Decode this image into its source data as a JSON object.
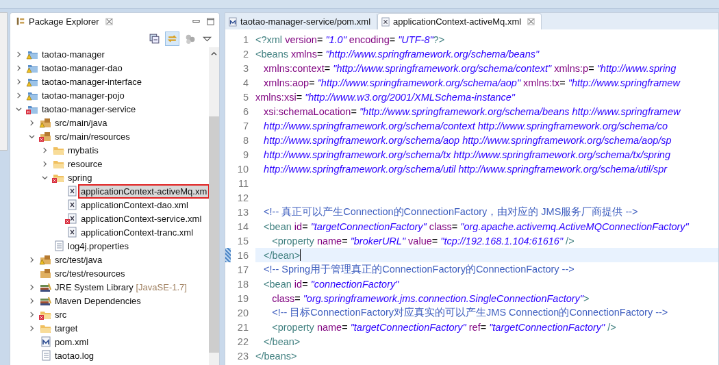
{
  "explorer": {
    "title": "Package Explorer",
    "tree": [
      {
        "label": "taotao-manager",
        "kind": "project",
        "warning": true,
        "error": false,
        "expanded": false,
        "selected": false
      },
      {
        "label": "taotao-manager-dao",
        "kind": "project",
        "warning": true,
        "error": false,
        "expanded": false,
        "selected": false
      },
      {
        "label": "taotao-manager-interface",
        "kind": "project",
        "warning": true,
        "error": false,
        "expanded": false,
        "selected": false
      },
      {
        "label": "taotao-manager-pojo",
        "kind": "project",
        "warning": true,
        "error": false,
        "expanded": false,
        "selected": false
      },
      {
        "label": "taotao-manager-service",
        "kind": "project",
        "warning": false,
        "error": true,
        "expanded": true,
        "selected": false,
        "children": [
          {
            "label": "src/main/java",
            "kind": "package",
            "warning": true,
            "error": false,
            "expanded": false,
            "selected": false
          },
          {
            "label": "src/main/resources",
            "kind": "package",
            "warning": false,
            "error": true,
            "expanded": true,
            "selected": false,
            "children": [
              {
                "label": "mybatis",
                "kind": "folder",
                "warning": false,
                "error": false,
                "expanded": false,
                "selected": false
              },
              {
                "label": "resource",
                "kind": "folder",
                "warning": false,
                "error": false,
                "expanded": false,
                "selected": false
              },
              {
                "label": "spring",
                "kind": "folder",
                "warning": false,
                "error": true,
                "expanded": true,
                "selected": false,
                "children": [
                  {
                    "label": "applicationContext-activeMq.xm",
                    "kind": "xml",
                    "warning": false,
                    "error": false,
                    "selected": true
                  },
                  {
                    "label": "applicationContext-dao.xml",
                    "kind": "xml",
                    "warning": false,
                    "error": false,
                    "selected": false
                  },
                  {
                    "label": "applicationContext-service.xml",
                    "kind": "xml",
                    "warning": false,
                    "error": true,
                    "selected": false
                  },
                  {
                    "label": "applicationContext-tranc.xml",
                    "kind": "xml",
                    "warning": false,
                    "error": false,
                    "selected": false
                  }
                ]
              },
              {
                "label": "log4j.properties",
                "kind": "file",
                "warning": false,
                "error": false,
                "selected": false
              }
            ]
          },
          {
            "label": "src/test/java",
            "kind": "package",
            "warning": true,
            "error": false,
            "expanded": false,
            "selected": false
          },
          {
            "label": "src/test/resources",
            "kind": "package",
            "warning": false,
            "error": false,
            "selected": false
          },
          {
            "label": "JRE System Library",
            "decoration": "[JavaSE-1.7]",
            "kind": "library",
            "warning": false,
            "error": false,
            "expanded": false,
            "selected": false
          },
          {
            "label": "Maven Dependencies",
            "kind": "library",
            "warning": false,
            "error": false,
            "expanded": false,
            "selected": false
          },
          {
            "label": "src",
            "kind": "folder",
            "warning": false,
            "error": true,
            "expanded": false,
            "selected": false
          },
          {
            "label": "target",
            "kind": "folder",
            "warning": false,
            "error": false,
            "expanded": false,
            "selected": false
          },
          {
            "label": "pom.xml",
            "kind": "pom",
            "warning": false,
            "error": false,
            "selected": false
          },
          {
            "label": "taotao.log",
            "kind": "file",
            "warning": false,
            "error": false,
            "selected": false
          }
        ]
      }
    ]
  },
  "editor": {
    "tabs": [
      {
        "label": "taotao-manager-service/pom.xml",
        "kind": "pom",
        "selected": false
      },
      {
        "label": "applicationContext-activeMq.xml",
        "kind": "xml",
        "selected": true
      }
    ],
    "lines": [
      {
        "no": "1",
        "current": false,
        "tokens": [
          {
            "kind": "tag",
            "text": "<?xml "
          },
          {
            "kind": "attr",
            "text": "version"
          },
          {
            "kind": "punct",
            "text": "= "
          },
          {
            "kind": "str",
            "text": "\"1.0\" "
          },
          {
            "kind": "attr",
            "text": "encoding"
          },
          {
            "kind": "punct",
            "text": "= "
          },
          {
            "kind": "str",
            "text": "\"UTF-8\""
          },
          {
            "kind": "tag",
            "text": "?>"
          }
        ]
      },
      {
        "no": "2",
        "current": false,
        "tokens": [
          {
            "kind": "tag",
            "text": "<beans "
          },
          {
            "kind": "attr",
            "text": "xmlns"
          },
          {
            "kind": "punct",
            "text": "= "
          },
          {
            "kind": "str",
            "text": "\"http://www.springframework.org/schema/beans\""
          }
        ]
      },
      {
        "no": "3",
        "current": false,
        "tokens": [
          {
            "kind": "attr",
            "text": "   xmlns:context"
          },
          {
            "kind": "punct",
            "text": "= "
          },
          {
            "kind": "str",
            "text": "\"http://www.springframework.org/schema/context\" "
          },
          {
            "kind": "attr",
            "text": "xmlns:p"
          },
          {
            "kind": "punct",
            "text": "= "
          },
          {
            "kind": "str",
            "text": "\"http://www.spring"
          }
        ]
      },
      {
        "no": "4",
        "current": false,
        "tokens": [
          {
            "kind": "attr",
            "text": "   xmlns:aop"
          },
          {
            "kind": "punct",
            "text": "= "
          },
          {
            "kind": "str",
            "text": "\"http://www.springframework.org/schema/aop\" "
          },
          {
            "kind": "attr",
            "text": "xmlns:tx"
          },
          {
            "kind": "punct",
            "text": "= "
          },
          {
            "kind": "str",
            "text": "\"http://www.springframew"
          }
        ]
      },
      {
        "no": "5",
        "current": false,
        "tokens": [
          {
            "kind": "attr",
            "text": "xmlns:xsi"
          },
          {
            "kind": "punct",
            "text": "= "
          },
          {
            "kind": "str",
            "text": "\"http://www.w3.org/2001/XMLSchema-instance\""
          }
        ]
      },
      {
        "no": "6",
        "current": false,
        "tokens": [
          {
            "kind": "attr",
            "text": "   xsi:schemaLocation"
          },
          {
            "kind": "punct",
            "text": "= "
          },
          {
            "kind": "str",
            "text": "\"http://www.springframework.org/schema/beans http://www.springframew"
          }
        ]
      },
      {
        "no": "7",
        "current": false,
        "tokens": [
          {
            "kind": "str",
            "text": "   http://www.springframework.org/schema/context http://www.springframework.org/schema/co"
          }
        ]
      },
      {
        "no": "8",
        "current": false,
        "tokens": [
          {
            "kind": "str",
            "text": "   http://www.springframework.org/schema/aop http://www.springframework.org/schema/aop/sp"
          }
        ]
      },
      {
        "no": "9",
        "current": false,
        "tokens": [
          {
            "kind": "str",
            "text": "   http://www.springframework.org/schema/tx http://www.springframework.org/schema/tx/spring"
          }
        ]
      },
      {
        "no": "10",
        "current": false,
        "tokens": [
          {
            "kind": "str",
            "text": "   http://www.springframework.org/schema/util http://www.springframework.org/schema/util/spr"
          }
        ]
      },
      {
        "no": "11",
        "current": false
      },
      {
        "no": "12",
        "current": false
      },
      {
        "no": "13",
        "current": false,
        "tokens": [
          {
            "kind": "comment",
            "text": "   <!-- 真正可以产生Connection的ConnectionFactory，由对应的 JMS服务厂商提供 -->"
          }
        ]
      },
      {
        "no": "14",
        "current": false,
        "tokens": [
          {
            "kind": "tag",
            "text": "   <bean "
          },
          {
            "kind": "attr",
            "text": "id"
          },
          {
            "kind": "punct",
            "text": "= "
          },
          {
            "kind": "str",
            "text": "\"targetConnectionFactory\" "
          },
          {
            "kind": "attr",
            "text": "class"
          },
          {
            "kind": "punct",
            "text": "= "
          },
          {
            "kind": "str",
            "text": "\"org.apache.activemq.ActiveMQConnectionFactory\""
          }
        ]
      },
      {
        "no": "15",
        "current": false,
        "tokens": [
          {
            "kind": "tag",
            "text": "      <property "
          },
          {
            "kind": "attr",
            "text": "name"
          },
          {
            "kind": "punct",
            "text": "= "
          },
          {
            "kind": "str",
            "text": "\"brokerURL\" "
          },
          {
            "kind": "attr",
            "text": "value"
          },
          {
            "kind": "punct",
            "text": "= "
          },
          {
            "kind": "str",
            "text": "\"tcp://192.168.1.104:61616\""
          },
          {
            "kind": "tag",
            "text": " />"
          }
        ]
      },
      {
        "no": "16",
        "current": true,
        "tokens": [
          {
            "kind": "tag",
            "text": "   </bean>"
          }
        ]
      },
      {
        "no": "17",
        "current": false,
        "tokens": [
          {
            "kind": "comment",
            "text": "   <!-- Spring用于管理真正的ConnectionFactory的ConnectionFactory -->"
          }
        ]
      },
      {
        "no": "18",
        "current": false,
        "tokens": [
          {
            "kind": "tag",
            "text": "   <bean "
          },
          {
            "kind": "attr",
            "text": "id"
          },
          {
            "kind": "punct",
            "text": "= "
          },
          {
            "kind": "str",
            "text": "\"connectionFactory\""
          }
        ]
      },
      {
        "no": "19",
        "current": false,
        "tokens": [
          {
            "kind": "attr",
            "text": "      class"
          },
          {
            "kind": "punct",
            "text": "= "
          },
          {
            "kind": "str",
            "text": "\"org.springframework.jms.connection.SingleConnectionFactory\""
          },
          {
            "kind": "tag",
            "text": ">"
          }
        ]
      },
      {
        "no": "20",
        "current": false,
        "tokens": [
          {
            "kind": "comment",
            "text": "      <!-- 目标ConnectionFactory对应真实的可以产生JMS Connection的ConnectionFactory -->"
          }
        ]
      },
      {
        "no": "21",
        "current": false,
        "tokens": [
          {
            "kind": "tag",
            "text": "      <property "
          },
          {
            "kind": "attr",
            "text": "name"
          },
          {
            "kind": "punct",
            "text": "= "
          },
          {
            "kind": "str",
            "text": "\"targetConnectionFactory\" "
          },
          {
            "kind": "attr",
            "text": "ref"
          },
          {
            "kind": "punct",
            "text": "= "
          },
          {
            "kind": "str",
            "text": "\"targetConnectionFactory\""
          },
          {
            "kind": "tag",
            "text": " />"
          }
        ]
      },
      {
        "no": "22",
        "current": false,
        "tokens": [
          {
            "kind": "tag",
            "text": "   </bean>"
          }
        ]
      },
      {
        "no": "23",
        "current": false,
        "tokens": [
          {
            "kind": "tag",
            "text": "</beans>"
          }
        ]
      }
    ]
  }
}
